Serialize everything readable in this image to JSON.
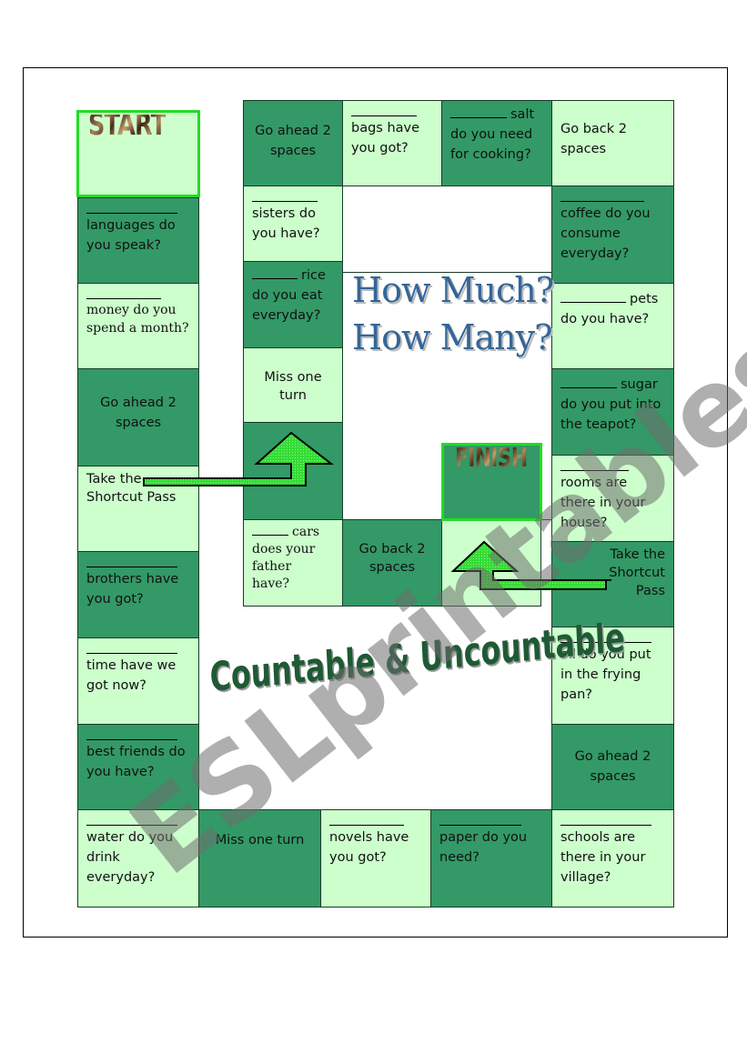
{
  "title": {
    "line1": "How Much?",
    "line2": "How Many?",
    "subtitle": "Countable & Uncountable"
  },
  "watermark": "ESLprintables.com",
  "colors": {
    "dark_square": "#339966",
    "light_square": "#ccffcc",
    "start_finish_border": "#22dd22",
    "arrow_fill": "#33cc33",
    "title_blue": "#336699",
    "subtitle_green": "#1e5a34"
  },
  "start": {
    "label": "START"
  },
  "finish": {
    "label": "FINISH"
  },
  "squares": {
    "left_col": [
      {
        "blank": true,
        "text": "languages do you speak?"
      },
      {
        "blank": true,
        "text": "money do you spend a month?"
      },
      {
        "blank": false,
        "text": "Go ahead 2 spaces"
      },
      {
        "blank": false,
        "text": "Take the Shortcut Pass"
      },
      {
        "blank": true,
        "text": "brothers have you got?"
      },
      {
        "blank": true,
        "text": "time have we got now?"
      },
      {
        "blank": true,
        "text": "best friends do you have?"
      },
      {
        "blank": true,
        "text": "water do you drink everyday?"
      }
    ],
    "bottom_row": [
      {
        "blank": false,
        "text": "Miss one turn"
      },
      {
        "blank": true,
        "text": "novels have you got?"
      },
      {
        "blank": true,
        "text": "paper do you need?"
      }
    ],
    "right_col": [
      {
        "blank": true,
        "text": "schools are there in your village?"
      },
      {
        "blank": false,
        "text": "Go ahead 2 spaces"
      },
      {
        "blank": true,
        "text": "oil do you put in the frying pan?"
      },
      {
        "blank": false,
        "text": "Take the Shortcut Pass"
      },
      {
        "blank": true,
        "text": "rooms are there in your house?"
      },
      {
        "blank": true,
        "word": "sugar",
        "text": "do you put into the teapot?"
      },
      {
        "blank": true,
        "word": "pets",
        "text": "do you have?"
      },
      {
        "blank": true,
        "text": "coffee do you consume everyday?"
      },
      {
        "blank": false,
        "text": "Go back 2 spaces"
      }
    ],
    "top_row": [
      {
        "blank": true,
        "word": "salt",
        "text": "do you need for cooking?"
      },
      {
        "blank": true,
        "text": "bags have you got?"
      },
      {
        "blank": false,
        "text": "Go ahead 2 spaces"
      }
    ],
    "inner_col": [
      {
        "blank": true,
        "text": "sisters do you have?"
      },
      {
        "blank": true,
        "word": "rice",
        "text": "do you eat everyday?"
      },
      {
        "blank": false,
        "text": "Miss one turn"
      }
    ],
    "inner_bottom": [
      {
        "blank": true,
        "word": "cars",
        "text": "does your father have?"
      },
      {
        "blank": false,
        "text": "Go back 2 spaces"
      }
    ]
  }
}
